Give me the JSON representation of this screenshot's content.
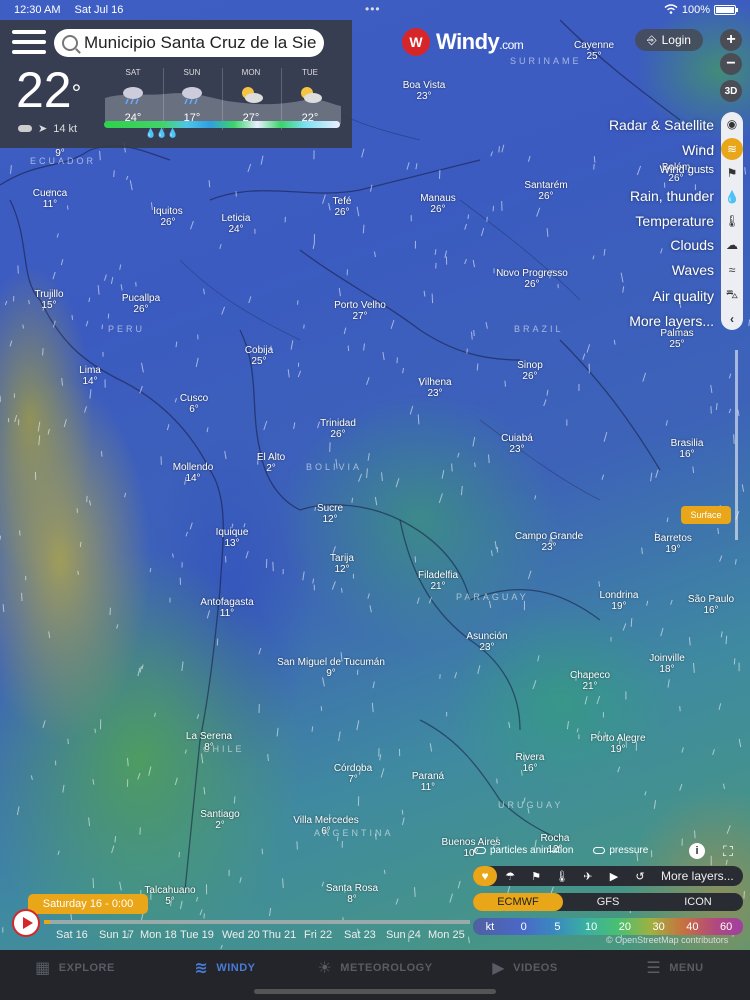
{
  "status_bar": {
    "time": "12:30 AM",
    "date": "Sat Jul 16",
    "dots": "•••",
    "battery": "100%"
  },
  "search": {
    "value": "Municipio Santa Cruz de la Sie"
  },
  "current": {
    "temp": "22",
    "degree": "°",
    "wind": "14 kt"
  },
  "forecast": [
    {
      "day": "SAT",
      "temp": "24°"
    },
    {
      "day": "SUN",
      "temp": "17°"
    },
    {
      "day": "MON",
      "temp": "27°"
    },
    {
      "day": "TUE",
      "temp": "22°"
    }
  ],
  "rain_icons": "💧💧💧",
  "logo": {
    "name": "Windy",
    "suffix": ".com"
  },
  "login_label": "Login",
  "zoom": {
    "in": "+",
    "out": "−",
    "mode_3d": "3D"
  },
  "layers": [
    {
      "label": "Radar & Satellite",
      "icon": "globe-icon"
    },
    {
      "label": "Wind",
      "icon": "wind-icon"
    },
    {
      "label": "Wind gusts",
      "icon": "flag-icon"
    },
    {
      "label": "Rain, thunder",
      "icon": "drop-icon"
    },
    {
      "label": "Temperature",
      "icon": "thermometer-icon"
    },
    {
      "label": "Clouds",
      "icon": "cloud-icon"
    },
    {
      "label": "Waves",
      "icon": "waves-icon"
    },
    {
      "label": "Air quality",
      "icon": "car-icon"
    },
    {
      "label": "More layers...",
      "icon": "chevron-left-icon"
    }
  ],
  "surface_label": "Surface",
  "cities": [
    {
      "name": "Cayenne",
      "temp": "25°"
    },
    {
      "name": "Boa Vista",
      "temp": "23°"
    },
    {
      "name": "Belém",
      "temp": "26°"
    },
    {
      "name": "Cuenca",
      "temp": "11°"
    },
    {
      "name": "Iquitos",
      "temp": "26°"
    },
    {
      "name": "Leticia",
      "temp": "24°"
    },
    {
      "name": "Tefé",
      "temp": "26°"
    },
    {
      "name": "Manaus",
      "temp": "26°"
    },
    {
      "name": "Santarém",
      "temp": "26°"
    },
    {
      "name": "Trujillo",
      "temp": "15°"
    },
    {
      "name": "Pucallpa",
      "temp": "26°"
    },
    {
      "name": "Novo Progresso",
      "temp": "26°"
    },
    {
      "name": "Porto Velho",
      "temp": "27°"
    },
    {
      "name": "Palmas",
      "temp": "25°"
    },
    {
      "name": "Cobija",
      "temp": "25°"
    },
    {
      "name": "Lima",
      "temp": "14°"
    },
    {
      "name": "Sinop",
      "temp": "26°"
    },
    {
      "name": "Vilhena",
      "temp": "23°"
    },
    {
      "name": "Cusco",
      "temp": "6°"
    },
    {
      "name": "Trinidad",
      "temp": "26°"
    },
    {
      "name": "Cuiabá",
      "temp": "23°"
    },
    {
      "name": "Brasilia",
      "temp": "16°"
    },
    {
      "name": "El Alto",
      "temp": "2°"
    },
    {
      "name": "Mollendo",
      "temp": "14°"
    },
    {
      "name": "Sucre",
      "temp": "12°"
    },
    {
      "name": "Iquique",
      "temp": "13°"
    },
    {
      "name": "Campo Grande",
      "temp": "23°"
    },
    {
      "name": "Barretos",
      "temp": "19°"
    },
    {
      "name": "Tarija",
      "temp": "12°"
    },
    {
      "name": "Filadelfia",
      "temp": "21°"
    },
    {
      "name": "Londrina",
      "temp": "19°"
    },
    {
      "name": "São Paulo",
      "temp": "16°"
    },
    {
      "name": "Antofagasta",
      "temp": "11°"
    },
    {
      "name": "Asunción",
      "temp": "23°"
    },
    {
      "name": "San Miguel de Tucumán",
      "temp": "9°"
    },
    {
      "name": "Joinville",
      "temp": "18°"
    },
    {
      "name": "Chapeco",
      "temp": "21°"
    },
    {
      "name": "La Serena",
      "temp": "8°"
    },
    {
      "name": "Porto Alegre",
      "temp": "19°"
    },
    {
      "name": "Córdoba",
      "temp": "7°"
    },
    {
      "name": "Paraná",
      "temp": "11°"
    },
    {
      "name": "Rivera",
      "temp": "16°"
    },
    {
      "name": "Santiago",
      "temp": "2°"
    },
    {
      "name": "Villa Mercedes",
      "temp": "6°"
    },
    {
      "name": "Buenos Aires",
      "temp": "10°"
    },
    {
      "name": "Rocha",
      "temp": "12°"
    },
    {
      "name": "Talcahuano",
      "temp": "5°"
    },
    {
      "name": "Santa Rosa",
      "temp": "8°"
    },
    {
      "name": "",
      "temp": "9°"
    }
  ],
  "countries": [
    "ECUADOR",
    "SURINAME",
    "PERU",
    "BRAZIL",
    "BOLIVIA",
    "PARAGUAY",
    "CHILE",
    "ARGENTINA",
    "URUGUAY"
  ],
  "toggles": {
    "particles": "particles animation",
    "pressure": "pressure"
  },
  "more_layers_label": "More layers...",
  "models": [
    "ECMWF",
    "GFS",
    "ICON"
  ],
  "legend": {
    "unit": "kt",
    "values": [
      "0",
      "5",
      "10",
      "20",
      "30",
      "40",
      "60"
    ]
  },
  "attribution": "© OpenStreetMap contributors",
  "timeline": {
    "current": "Saturday 16 - 0:00",
    "days": [
      "Sat 16",
      "Sun 17",
      "Mon 18",
      "Tue 19",
      "Wed 20",
      "Thu 21",
      "Fri 22",
      "Sat 23",
      "Sun 24",
      "Mon 25"
    ]
  },
  "tabs": [
    {
      "label": "EXPLORE",
      "icon": "map-icon"
    },
    {
      "label": "WINDY",
      "icon": "wind-icon"
    },
    {
      "label": "METEOROLOGY",
      "icon": "sun-icon"
    },
    {
      "label": "VIDEOS",
      "icon": "play-icon"
    },
    {
      "label": "MENU",
      "icon": "menu-icon"
    }
  ]
}
